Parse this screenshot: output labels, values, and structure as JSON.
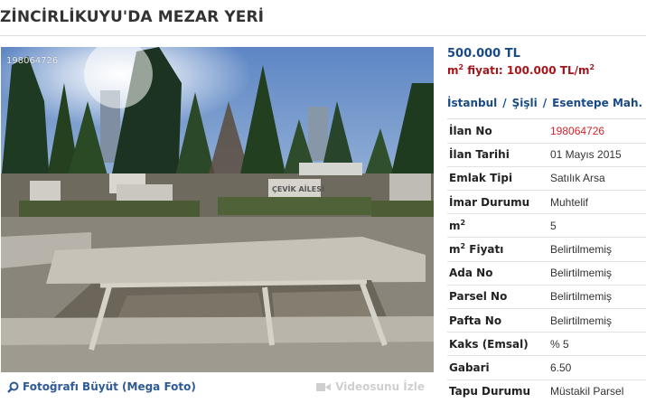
{
  "listing": {
    "title": "ZİNCİRLİKUYU'DA MEZAR YERİ",
    "photo_id": "198064726",
    "enlarge_photo_label": "Fotoğrafı Büyüt (Mega Foto)",
    "video_label": "Videosunu İzle",
    "price": "500.000 TL",
    "m2_price_prefix": "m",
    "m2_price_sup": "2",
    "m2_price_label": " fiyatı: ",
    "m2_price_value": "100.000 TL/m",
    "m2_price_value_sup": "2",
    "location": {
      "city": "İstanbul",
      "district": "Şişli",
      "neighborhood": "Esentepe Mah.",
      "separator": "/"
    },
    "details": [
      {
        "label": "İlan No",
        "value": "198064726",
        "highlight": true
      },
      {
        "label": "İlan Tarihi",
        "value": "01 Mayıs 2015"
      },
      {
        "label": "Emlak Tipi",
        "value": "Satılık Arsa"
      },
      {
        "label": "İmar Durumu",
        "value": "Muhtelif"
      },
      {
        "label": "m",
        "label_sup": "2",
        "value": "5"
      },
      {
        "label": "m",
        "label_sup": "2",
        "label_suffix": " Fiyatı",
        "value": "Belirtilmemiş"
      },
      {
        "label": "Ada No",
        "value": "Belirtilmemiş"
      },
      {
        "label": "Parsel No",
        "value": "Belirtilmemiş"
      },
      {
        "label": "Pafta No",
        "value": "Belirtilmemiş"
      },
      {
        "label": "Kaks (Emsal)",
        "value": "% 5"
      },
      {
        "label": "Gabari",
        "value": "6.50"
      },
      {
        "label": "Tapu Durumu",
        "value": "Müstakil Parsel"
      }
    ]
  },
  "colors": {
    "price": "#1a4a86",
    "m2_price": "#a4161b",
    "highlight_value": "#d0242b",
    "link": "#2e5a95",
    "disabled_link": "#cfcfcf"
  },
  "photo_signs": [
    "ÇEVİK AİLESİ"
  ]
}
